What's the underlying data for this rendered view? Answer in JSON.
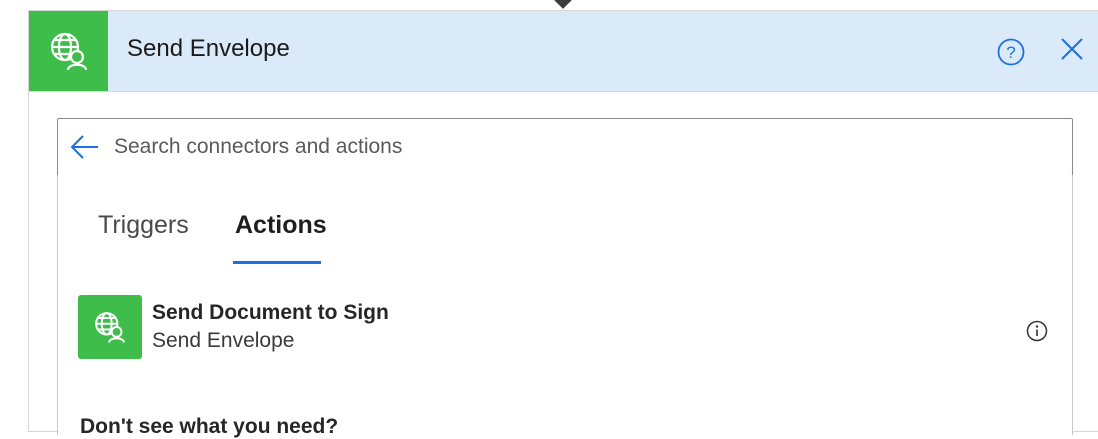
{
  "header": {
    "title": "Send Envelope",
    "accent_color": "#3fbd4b",
    "background_color": "#dbeaf8",
    "icon": "globe-user-icon"
  },
  "search": {
    "placeholder": "Search connectors and actions",
    "value": ""
  },
  "tabs": [
    {
      "label": "Triggers",
      "selected": false
    },
    {
      "label": "Actions",
      "selected": true
    }
  ],
  "actions": [
    {
      "title": "Send Document to Sign",
      "subtitle": "Send Envelope",
      "icon": "globe-user-icon"
    }
  ],
  "footer": {
    "prompt": "Don't see what you need?"
  },
  "colors": {
    "tab_underline": "#1f6fe0",
    "help_icon": "#1f6fe0",
    "close_icon": "#1f6fe0"
  }
}
